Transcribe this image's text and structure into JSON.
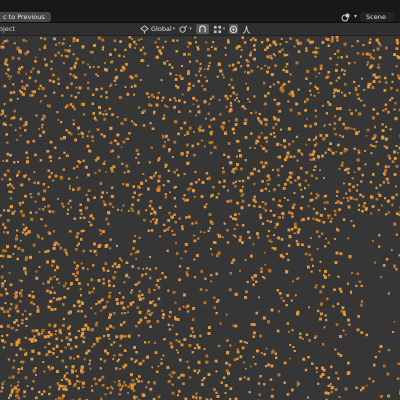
{
  "window": {
    "back_button_label": "c to Previous",
    "scene_label": "Scene"
  },
  "viewport_header": {
    "mode_label": "oject",
    "orientation_label": "Global"
  },
  "icons": [
    "scene-icon",
    "chevron-down-icon",
    "orientation-icon",
    "pivot-icon",
    "snap-icon",
    "snap-increment-icon",
    "proportional-edit-icon",
    "falloff-icon"
  ],
  "colors": {
    "point_color": "#e3963a",
    "point_color_dim": "#b8742a",
    "background": "#363636"
  }
}
